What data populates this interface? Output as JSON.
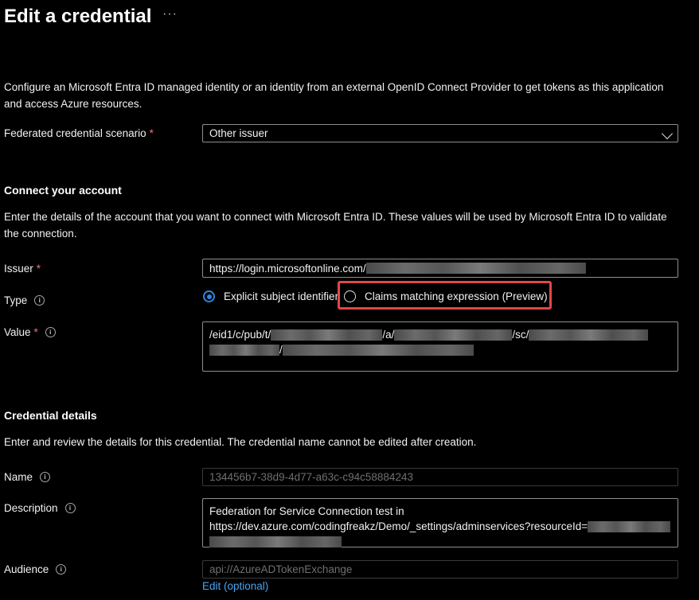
{
  "header": {
    "title": "Edit a credential",
    "more_label": "···"
  },
  "intro": "Configure an Microsoft Entra ID managed identity or an identity from an external OpenID Connect Provider to get tokens as this application and access Azure resources.",
  "scenario": {
    "label": "Federated credential scenario",
    "required_mark": "*",
    "value": "Other issuer"
  },
  "connect": {
    "heading": "Connect your account",
    "description": "Enter the details of the account that you want to connect with Microsoft Entra ID. These values will be used by Microsoft Entra ID to validate the connection.",
    "issuer": {
      "label": "Issuer",
      "required_mark": "*",
      "value": "https://login.microsoftonline.com/"
    },
    "type": {
      "label": "Type",
      "options": [
        {
          "label": "Explicit subject identifier",
          "selected": true
        },
        {
          "label": "Claims matching expression (Preview)",
          "selected": false
        }
      ]
    },
    "value": {
      "label": "Value",
      "required_mark": "*",
      "parts": [
        "/eid1/c/pub/t/",
        "/a/",
        "/sc/",
        "/"
      ]
    }
  },
  "details": {
    "heading": "Credential details",
    "description": "Enter and review the details for this credential. The credential name cannot be edited after creation.",
    "name": {
      "label": "Name",
      "value": "134456b7-38d9-4d77-a63c-c94c58884243"
    },
    "description_field": {
      "label": "Description",
      "line1": "Federation for Service Connection test in",
      "line2": "https://dev.azure.com/codingfreakz/Demo/_settings/adminservices?resourceId="
    },
    "audience": {
      "label": "Audience",
      "value": "api://AzureADTokenExchange",
      "edit_link": "Edit (optional)"
    }
  },
  "colors": {
    "background": "#000000",
    "accent": "#2e86de",
    "required": "#f1707b",
    "highlight": "#e04848",
    "link": "#4aa3f0"
  },
  "icons": [
    "info-icon",
    "chevron-down-icon",
    "more-icon"
  ]
}
